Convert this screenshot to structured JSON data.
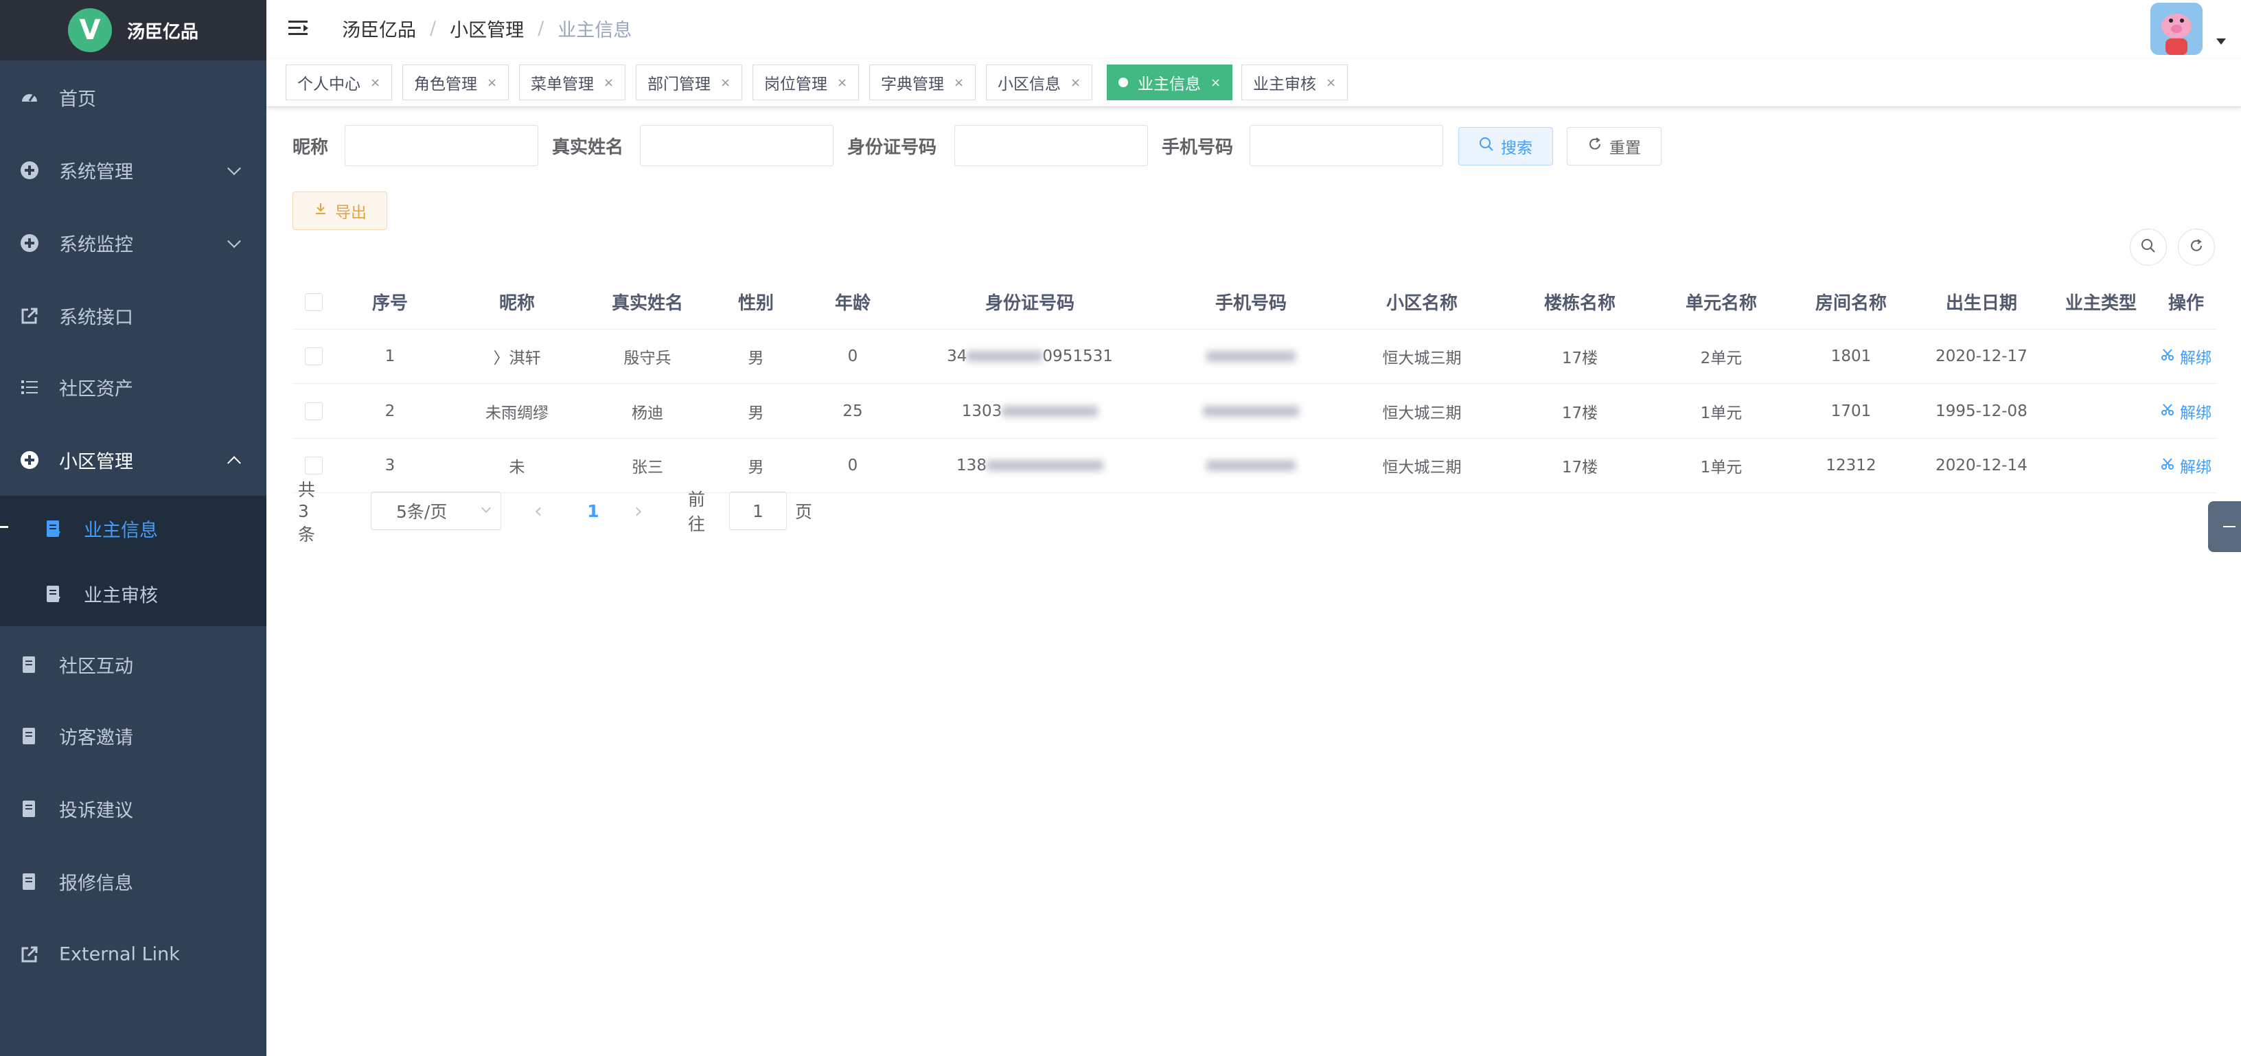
{
  "logo": {
    "title": "汤臣亿品",
    "mark": "V"
  },
  "sidebar": {
    "items": [
      {
        "label": "首页",
        "icon": "dashboard-icon"
      },
      {
        "label": "系统管理",
        "icon": "system-icon"
      },
      {
        "label": "系统监控",
        "icon": "monitor-icon"
      },
      {
        "label": "系统接口",
        "icon": "link-icon"
      },
      {
        "label": "社区资产",
        "icon": "list-icon"
      },
      {
        "label": "小区管理",
        "icon": "community-icon"
      },
      {
        "label": "社区互动",
        "icon": "document-icon"
      },
      {
        "label": "访客邀请",
        "icon": "document-icon"
      },
      {
        "label": "投诉建议",
        "icon": "document-icon"
      },
      {
        "label": "报修信息",
        "icon": "document-icon"
      },
      {
        "label": "External Link",
        "icon": "link-icon"
      }
    ],
    "submenu": [
      {
        "label": "业主信息",
        "active": true
      },
      {
        "label": "业主审核",
        "active": false
      }
    ]
  },
  "breadcrumb": [
    "汤臣亿品",
    "小区管理",
    "业主信息"
  ],
  "tags": [
    {
      "label": "个人中心",
      "close": "×"
    },
    {
      "label": "角色管理",
      "close": "×"
    },
    {
      "label": "菜单管理",
      "close": "×"
    },
    {
      "label": "部门管理",
      "close": "×"
    },
    {
      "label": "岗位管理",
      "close": "×"
    },
    {
      "label": "字典管理",
      "close": "×"
    },
    {
      "label": "小区信息",
      "close": "×"
    },
    {
      "label": "业主信息",
      "close": "×",
      "active": true
    },
    {
      "label": "业主审核",
      "close": "×"
    }
  ],
  "search": {
    "nickname_label": "昵称",
    "realname_label": "真实姓名",
    "idcard_label": "身份证号码",
    "phone_label": "手机号码",
    "search_button": "搜索",
    "reset_button": "重置",
    "export_button": "导出"
  },
  "table": {
    "headers": [
      "序号",
      "昵称",
      "真实姓名",
      "性别",
      "年龄",
      "身份证号码",
      "手机号码",
      "小区名称",
      "楼栋名称",
      "单元名称",
      "房间名称",
      "出生日期",
      "业主类型",
      "操作"
    ],
    "rows": [
      {
        "index": "1",
        "nickname": "〉淇轩",
        "realname": "殷守兵",
        "gender": "男",
        "age": "0",
        "idcard_prefix": "34",
        "idcard_suffix": "0951531",
        "phone": "",
        "community": "恒大城三期",
        "building": "17楼",
        "unit": "2单元",
        "room": "1801",
        "birth": "2020-12-17",
        "owner_type": "",
        "action": "解绑"
      },
      {
        "index": "2",
        "nickname": "未雨绸缪",
        "realname": "杨迪",
        "gender": "男",
        "age": "25",
        "idcard_prefix": "1303",
        "idcard_suffix": "",
        "phone": "",
        "community": "恒大城三期",
        "building": "17楼",
        "unit": "1单元",
        "room": "1701",
        "birth": "1995-12-08",
        "owner_type": "",
        "action": "解绑"
      },
      {
        "index": "3",
        "nickname": "未",
        "realname": "张三",
        "gender": "男",
        "age": "0",
        "idcard_prefix": "138",
        "idcard_suffix": "",
        "phone": "",
        "community": "恒大城三期",
        "building": "17楼",
        "unit": "1单元",
        "room": "12312",
        "birth": "2020-12-14",
        "owner_type": "",
        "action": "解绑"
      }
    ]
  },
  "pagination": {
    "total": "共 3 条",
    "page_size": "5条/页",
    "current_page": "1",
    "goto_label": "前往",
    "goto_value": "1",
    "page_suffix": "页"
  },
  "colors": {
    "sidebar_bg": "#304156",
    "active_tag": "#42b983",
    "primary": "#409eff",
    "warning": "#e6a23c"
  }
}
